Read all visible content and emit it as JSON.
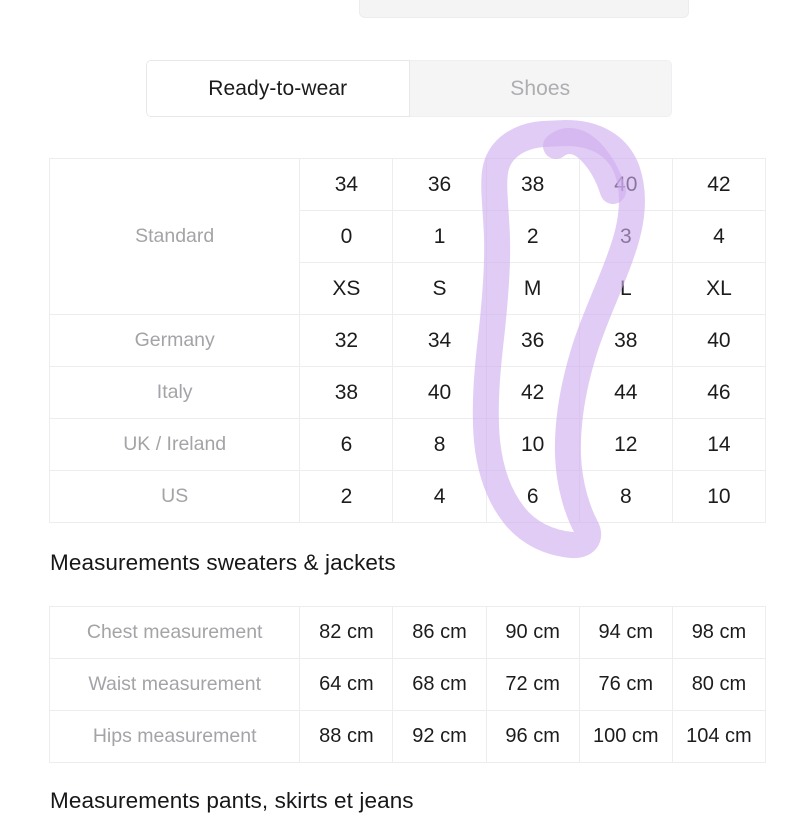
{
  "tabs": {
    "items": [
      {
        "label": "Ready-to-wear",
        "active": true
      },
      {
        "label": "Shoes",
        "active": false
      }
    ]
  },
  "sizes_table": {
    "rows": [
      {
        "label": "Standard",
        "label_rowspan": 3,
        "values": [
          "34",
          "36",
          "38",
          "40",
          "42"
        ]
      },
      {
        "label": "",
        "label_rowspan": 0,
        "values": [
          "0",
          "1",
          "2",
          "3",
          "4"
        ]
      },
      {
        "label": "",
        "label_rowspan": 0,
        "values": [
          "XS",
          "S",
          "M",
          "L",
          "XL"
        ]
      },
      {
        "label": "Germany",
        "label_rowspan": 1,
        "values": [
          "32",
          "34",
          "36",
          "38",
          "40"
        ]
      },
      {
        "label": "Italy",
        "label_rowspan": 1,
        "values": [
          "38",
          "40",
          "42",
          "44",
          "46"
        ]
      },
      {
        "label": "UK / Ireland",
        "label_rowspan": 1,
        "values": [
          "6",
          "8",
          "10",
          "12",
          "14"
        ]
      },
      {
        "label": "US",
        "label_rowspan": 1,
        "values": [
          "2",
          "4",
          "6",
          "8",
          "10"
        ]
      }
    ]
  },
  "sweaters_heading": "Measurements sweaters & jackets",
  "sweaters_table": {
    "rows": [
      {
        "label": "Chest measurement",
        "values": [
          "82 cm",
          "86 cm",
          "90 cm",
          "94 cm",
          "98 cm"
        ]
      },
      {
        "label": "Waist measurement",
        "values": [
          "64 cm",
          "68 cm",
          "72 cm",
          "76 cm",
          "80 cm"
        ]
      },
      {
        "label": "Hips measurement",
        "values": [
          "88 cm",
          "92 cm",
          "96 cm",
          "100 cm",
          "104 cm"
        ]
      }
    ]
  },
  "pants_heading": "Measurements pants, skirts et jeans",
  "annotation": {
    "kind": "handdrawn-loop-highlight",
    "color": "#ceacef",
    "opacity": 0.62,
    "stroke_width": 26,
    "encircles_column": "M"
  },
  "colors": {
    "highlight": "#ceacef",
    "text_primary": "#1c1c1e",
    "text_muted": "#a4a4a8",
    "tab_inactive_bg": "#f5f5f6",
    "table_border": "#ededef"
  }
}
